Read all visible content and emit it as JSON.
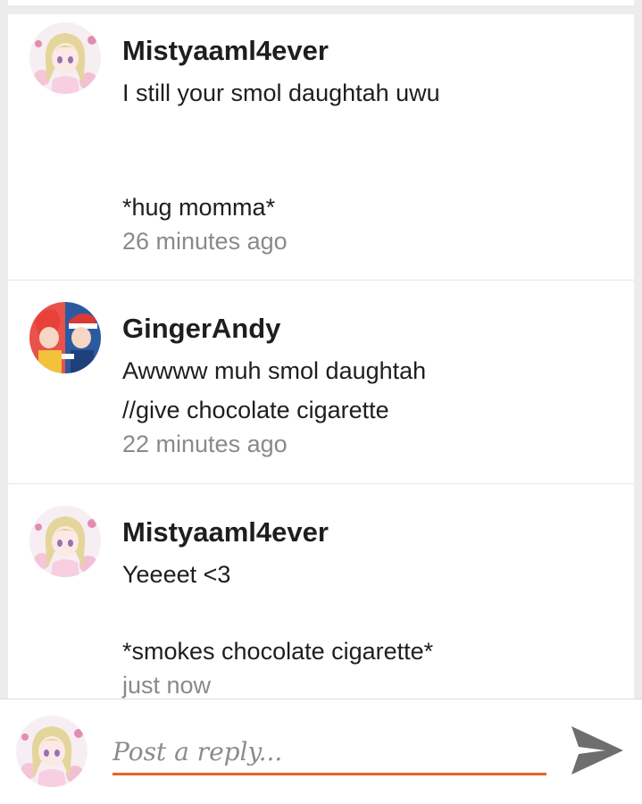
{
  "comments": [
    {
      "username": "Mistyaaml4ever",
      "avatar": "anime-girl-avatar",
      "lines": [
        "I still your smol daughtah uwu",
        "",
        "",
        "*hug momma*"
      ],
      "time": "26 minutes ago"
    },
    {
      "username": "GingerAndy",
      "avatar": "pokemon-duo-avatar",
      "lines": [
        "Awwww muh smol daughtah",
        "//give chocolate cigarette"
      ],
      "time": "22 minutes ago"
    },
    {
      "username": "Mistyaaml4ever",
      "avatar": "anime-girl-avatar",
      "lines": [
        "Yeeeet <3",
        "",
        "*smokes chocolate cigarette*"
      ],
      "time": "just now"
    }
  ],
  "reply": {
    "placeholder": "Post a reply...",
    "accent_color": "#e8612c",
    "send_icon": "send-arrow-icon"
  }
}
